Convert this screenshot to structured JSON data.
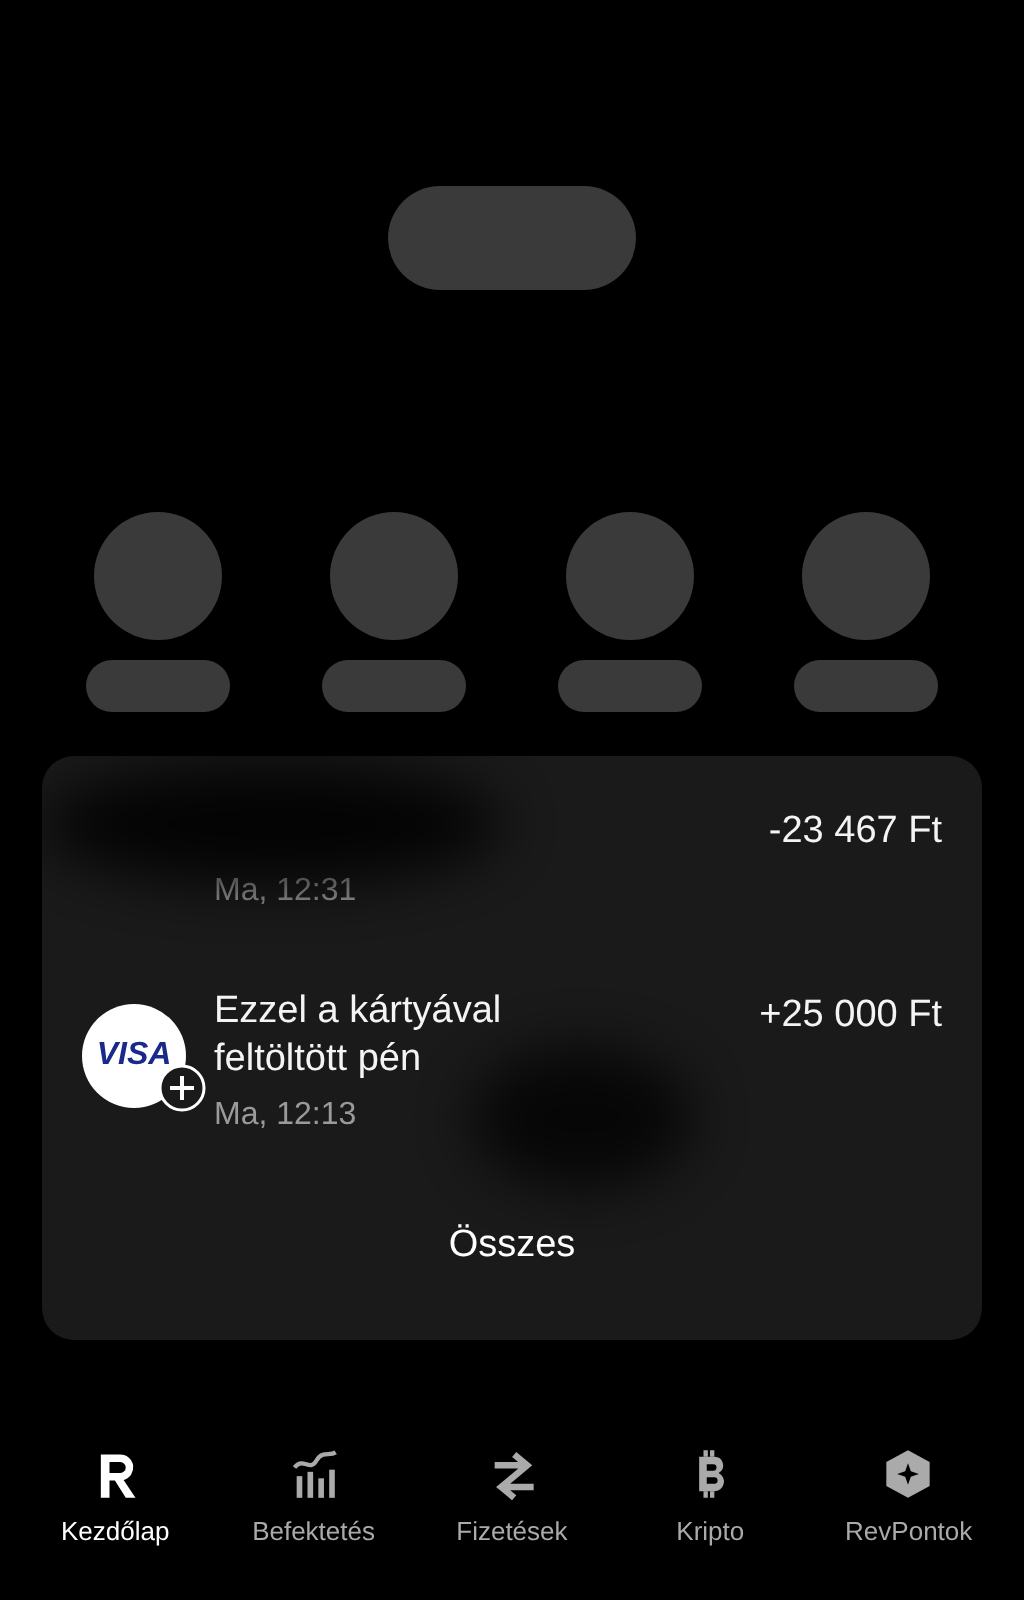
{
  "transactions": [
    {
      "kind": "plain",
      "time": "Ma, 12:31",
      "amount": "-23 467 Ft",
      "redacted": true
    },
    {
      "kind": "card",
      "icon_text": "VISA",
      "title": "Ezzel a kártyával feltöltött pén",
      "time": "Ma, 12:13",
      "amount": "+25 000 Ft",
      "redacted": true
    }
  ],
  "see_all": "Összes",
  "nav": [
    {
      "kind": "home",
      "label": "Kezdőlap",
      "selected": true
    },
    {
      "kind": "invest",
      "label": "Befektetés",
      "selected": false
    },
    {
      "kind": "payments",
      "label": "Fizetések",
      "selected": false
    },
    {
      "kind": "crypto",
      "label": "Kripto",
      "selected": false
    },
    {
      "kind": "points",
      "label": "RevPontok",
      "selected": false
    }
  ]
}
